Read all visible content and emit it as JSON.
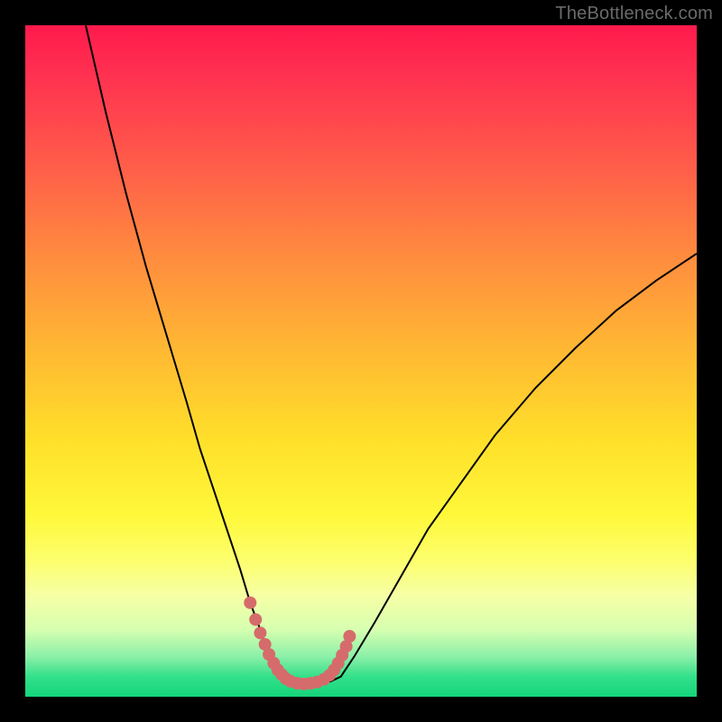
{
  "watermark": "TheBottleneck.com",
  "chart_data": {
    "type": "line",
    "title": "",
    "xlabel": "",
    "ylabel": "",
    "xlim": [
      0,
      100
    ],
    "ylim": [
      0,
      100
    ],
    "series": [
      {
        "name": "left-curve",
        "x": [
          9,
          12,
          15,
          18,
          21,
          24,
          26,
          28,
          30,
          32,
          33.5,
          35,
          36,
          37,
          38,
          38.8
        ],
        "y": [
          100,
          87,
          75,
          64,
          54,
          44,
          37,
          31,
          25,
          19,
          14,
          10,
          7,
          5,
          3.5,
          2.5
        ]
      },
      {
        "name": "bottom-flat",
        "x": [
          38.8,
          40,
          42,
          44,
          45.5,
          47
        ],
        "y": [
          2.5,
          2,
          1.8,
          2,
          2.3,
          3
        ]
      },
      {
        "name": "right-curve",
        "x": [
          47,
          49,
          52,
          56,
          60,
          65,
          70,
          76,
          82,
          88,
          94,
          100
        ],
        "y": [
          3,
          6,
          11,
          18,
          25,
          32,
          39,
          46,
          52,
          57.5,
          62,
          66
        ]
      },
      {
        "name": "highlight-dots",
        "x": [
          33.5,
          34.3,
          35,
          35.7,
          36.3,
          37,
          37.6,
          38.2,
          38.8,
          39.5,
          40.5,
          41.5,
          42.5,
          43.5,
          44.5,
          45.3,
          46,
          46.6,
          47.2,
          47.8,
          48.3
        ],
        "y": [
          14,
          11.5,
          9.5,
          7.8,
          6.3,
          5,
          4,
          3.3,
          2.7,
          2.3,
          2,
          1.9,
          2,
          2.2,
          2.6,
          3.2,
          4,
          5,
          6.2,
          7.5,
          9
        ]
      }
    ],
    "colors": {
      "curve": "#000000",
      "highlight": "#d66b6b"
    }
  }
}
